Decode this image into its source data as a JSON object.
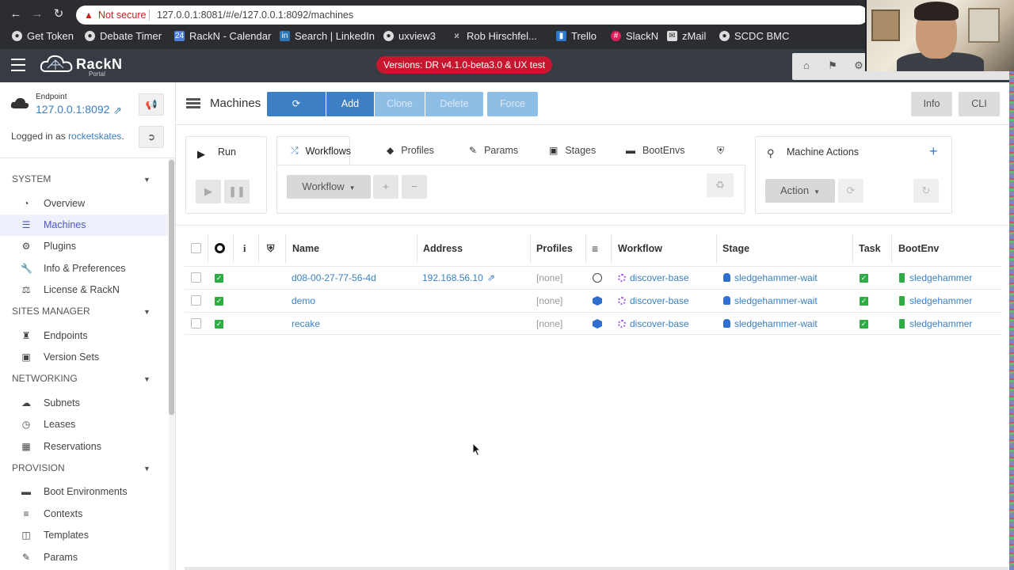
{
  "browser": {
    "not_secure": "Not secure",
    "url": "127.0.0.1:8081/#/e/127.0.0.1:8092/machines",
    "bookmarks": [
      {
        "label": "Get Token",
        "icon": "globe-icon"
      },
      {
        "label": "Debate Timer",
        "icon": "globe-icon"
      },
      {
        "label": "RackN - Calendar",
        "icon": "calendar-icon"
      },
      {
        "label": "Search | LinkedIn",
        "icon": "linkedin-icon"
      },
      {
        "label": "uxview3",
        "icon": "github-icon"
      },
      {
        "label": "Rob Hirschfel...",
        "icon": "medal-icon"
      },
      {
        "label": "Trello",
        "icon": "trello-icon"
      },
      {
        "label": "SlackN",
        "icon": "slack-icon"
      },
      {
        "label": "zMail",
        "icon": "mail-icon"
      },
      {
        "label": "SCDC BMC",
        "icon": "globe-icon"
      }
    ]
  },
  "app": {
    "logo_text": "RackN",
    "logo_sub": "Portal",
    "version_badge": "Versions: DR v4.1.0-beta3.0 & UX test"
  },
  "sidebar": {
    "endpoint_label": "Endpoint",
    "endpoint_value": "127.0.0.1:8092",
    "logged_in_prefix": "Logged in as ",
    "logged_in_user": "rocketskates",
    "logged_in_suffix": ".",
    "sections": [
      {
        "title": "SYSTEM",
        "items": [
          {
            "label": "Overview",
            "icon": "dashboard-icon"
          },
          {
            "label": "Machines",
            "icon": "server-icon",
            "active": true
          },
          {
            "label": "Plugins",
            "icon": "cogs-icon"
          },
          {
            "label": "Info & Preferences",
            "icon": "wrench-icon"
          },
          {
            "label": "License & RackN",
            "icon": "balance-icon"
          }
        ]
      },
      {
        "title": "SITES MANAGER",
        "items": [
          {
            "label": "Endpoints",
            "icon": "chess-rook-icon"
          },
          {
            "label": "Version Sets",
            "icon": "briefcase-icon"
          }
        ]
      },
      {
        "title": "NETWORKING",
        "items": [
          {
            "label": "Subnets",
            "icon": "cloud-icon"
          },
          {
            "label": "Leases",
            "icon": "clock-icon"
          },
          {
            "label": "Reservations",
            "icon": "calendar-icon"
          }
        ]
      },
      {
        "title": "PROVISION",
        "items": [
          {
            "label": "Boot Environments",
            "icon": "hdd-icon"
          },
          {
            "label": "Contexts",
            "icon": "list-icon"
          },
          {
            "label": "Templates",
            "icon": "file-icon"
          },
          {
            "label": "Params",
            "icon": "pencil-icon"
          }
        ]
      }
    ]
  },
  "header": {
    "title": "Machines",
    "buttons": {
      "add": "Add",
      "clone": "Clone",
      "delete": "Delete",
      "force": "Force",
      "info": "Info",
      "cli": "CLI"
    }
  },
  "run_panel": {
    "label": "Run"
  },
  "tabs": [
    {
      "label": "Workflows",
      "icon": "shuffle-icon",
      "active": true
    },
    {
      "label": "Profiles",
      "icon": "tags-icon"
    },
    {
      "label": "Params",
      "icon": "pencil-icon"
    },
    {
      "label": "Stages",
      "icon": "sitemap-icon"
    },
    {
      "label": "BootEnvs",
      "icon": "hdd-icon"
    },
    {
      "label": "",
      "icon": "shield-icon"
    }
  ],
  "workflow_select": "Workflow",
  "machine_actions": {
    "title": "Machine Actions",
    "action_select": "Action"
  },
  "table": {
    "columns": [
      "Name",
      "Address",
      "Profiles",
      "Workflow",
      "Stage",
      "Task",
      "BootEnv"
    ],
    "rows": [
      {
        "name": "d08-00-27-77-56-4d",
        "address": "192.168.56.10",
        "profiles": "[none]",
        "status_icon": "circle-icon",
        "workflow": "discover-base",
        "stage": "sledgehammer-wait",
        "bootenv": "sledgehammer"
      },
      {
        "name": "demo",
        "address": "",
        "profiles": "[none]",
        "status_icon": "cube-icon",
        "workflow": "discover-base",
        "stage": "sledgehammer-wait",
        "bootenv": "sledgehammer"
      },
      {
        "name": "recake",
        "address": "",
        "profiles": "[none]",
        "status_icon": "cube-icon",
        "workflow": "discover-base",
        "stage": "sledgehammer-wait",
        "bootenv": "sledgehammer"
      }
    ]
  }
}
